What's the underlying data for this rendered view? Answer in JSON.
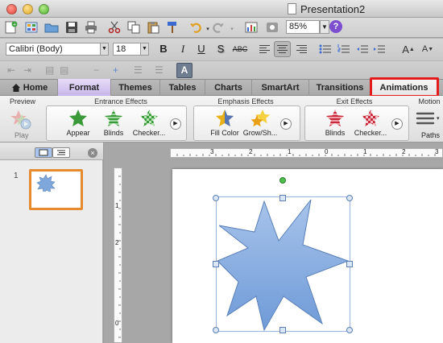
{
  "window": {
    "title": "Presentation2"
  },
  "toolbar": {
    "zoom": "85%",
    "help": "?"
  },
  "formatting": {
    "font": "Calibri (Body)",
    "size": "18",
    "bold": "B",
    "italic": "I",
    "underline": "U",
    "shadow": "S",
    "strikethrough": "ABC",
    "text_direction": "A"
  },
  "ribbon": {
    "tabs": [
      "Home",
      "Format",
      "Themes",
      "Tables",
      "Charts",
      "SmartArt",
      "Transitions",
      "Animations"
    ],
    "active_tab": "Animations",
    "highlight_color": "#e41b1b",
    "groups": {
      "preview": {
        "label": "Preview",
        "play": "Play"
      },
      "entrance": {
        "label": "Entrance Effects",
        "items": [
          "Appear",
          "Blinds",
          "Checker..."
        ],
        "color": "#3a9a3a"
      },
      "emphasis": {
        "label": "Emphasis Effects",
        "items": [
          "Fill Color",
          "Grow/Sh..."
        ],
        "color": "#e8b018"
      },
      "exit": {
        "label": "Exit Effects",
        "items": [
          "Blinds",
          "Checker..."
        ],
        "color": "#c8283a"
      },
      "motion": {
        "label": "Motion",
        "paths": "Paths"
      }
    }
  },
  "sidebar": {
    "slide_number": "1"
  },
  "rulers": {
    "h_labels": [
      "3",
      "2",
      "1",
      "0",
      "1",
      "2",
      "3"
    ],
    "v_labels": [
      "1",
      "2",
      "0"
    ]
  },
  "slide": {
    "shape": "star-burst",
    "shape_color": "#7ea7dc"
  }
}
